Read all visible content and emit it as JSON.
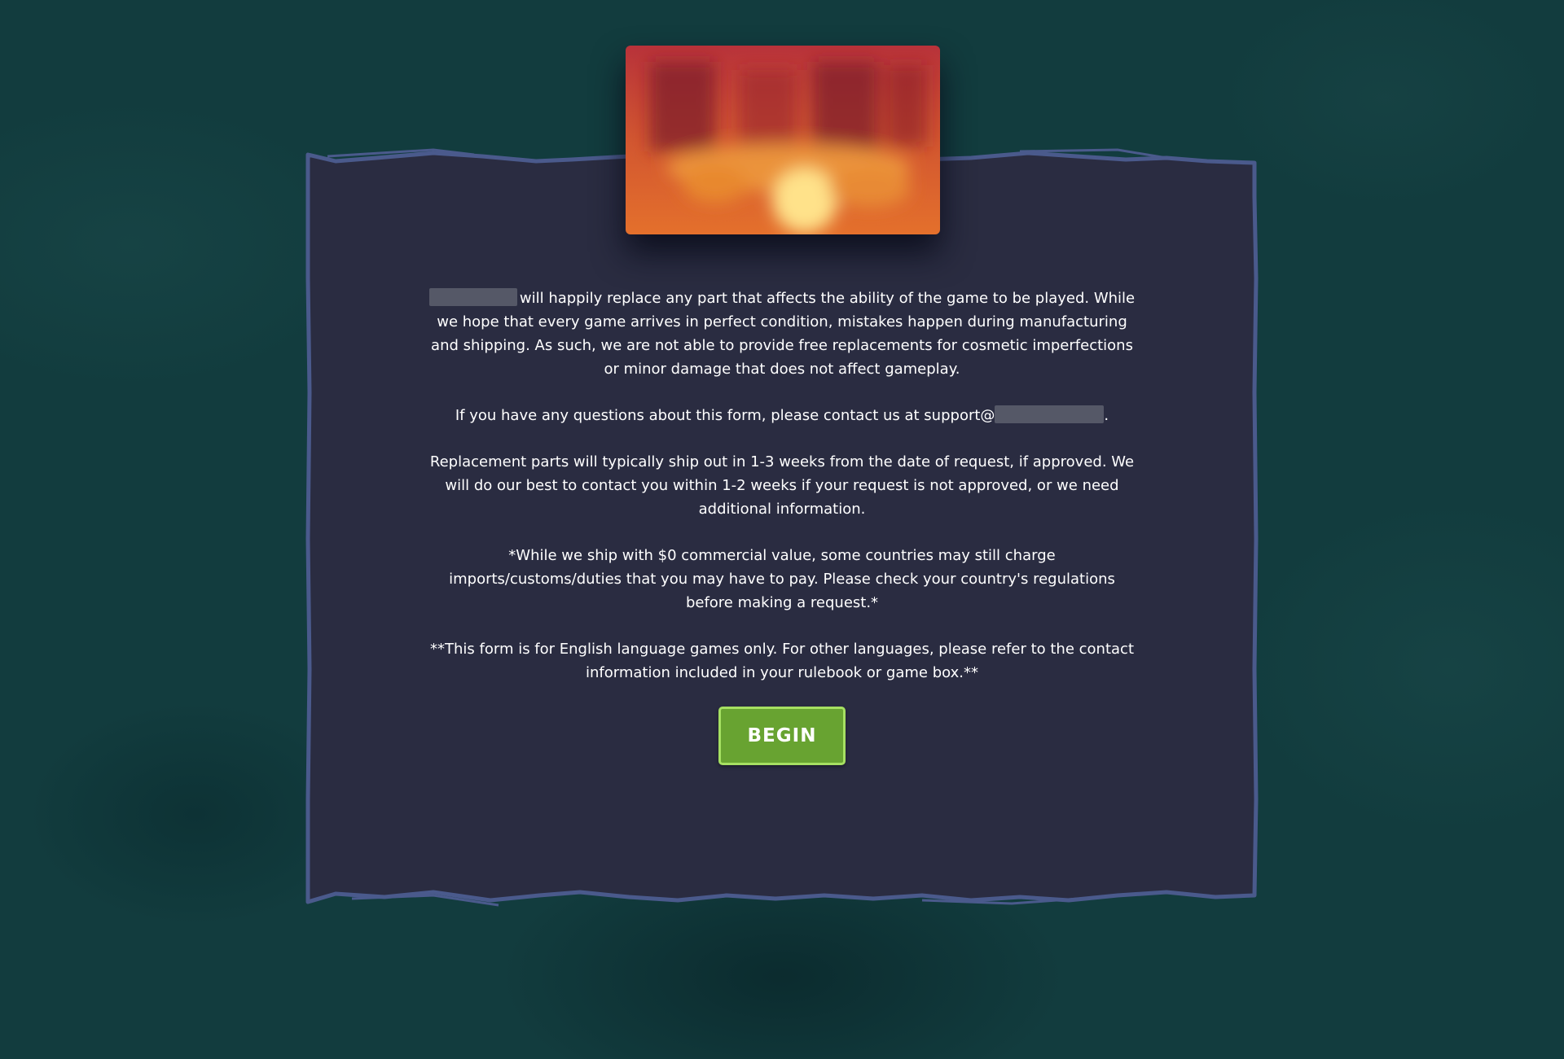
{
  "logo": {
    "icon": "game-logo-blurred"
  },
  "intro": {
    "brand_redacted": "",
    "text": "will happily replace any part that affects the ability of the game to be played. While we hope that every game arrives in perfect condition, mistakes happen during manufacturing and shipping. As such, we are not able to provide free replacements for cosmetic imperfections or minor damage that does not affect gameplay."
  },
  "contact": {
    "prefix": "If you have any questions about this form, please contact us at support@",
    "email_domain_redacted": "",
    "suffix": "."
  },
  "shipping_note": "Replacement parts will typically ship out in 1-3 weeks from the date of request, if approved. We will do our best to contact you within 1-2 weeks if your request is not approved, or we need additional information.",
  "customs_note": "*While we ship with $0 commercial value, some countries may still charge imports/customs/duties that you may have to pay. Please check your country's regulations before making a request.*",
  "language_note": "**This form is for English language games only. For other languages, please refer to the contact information included in your rulebook or game box.**",
  "begin_button": {
    "label": "BEGIN"
  },
  "colors": {
    "background": "#123c3e",
    "panel": "#2a2c41",
    "panel_border": "#4a5a8c",
    "button": "#68a331",
    "button_border": "#a6e062"
  }
}
